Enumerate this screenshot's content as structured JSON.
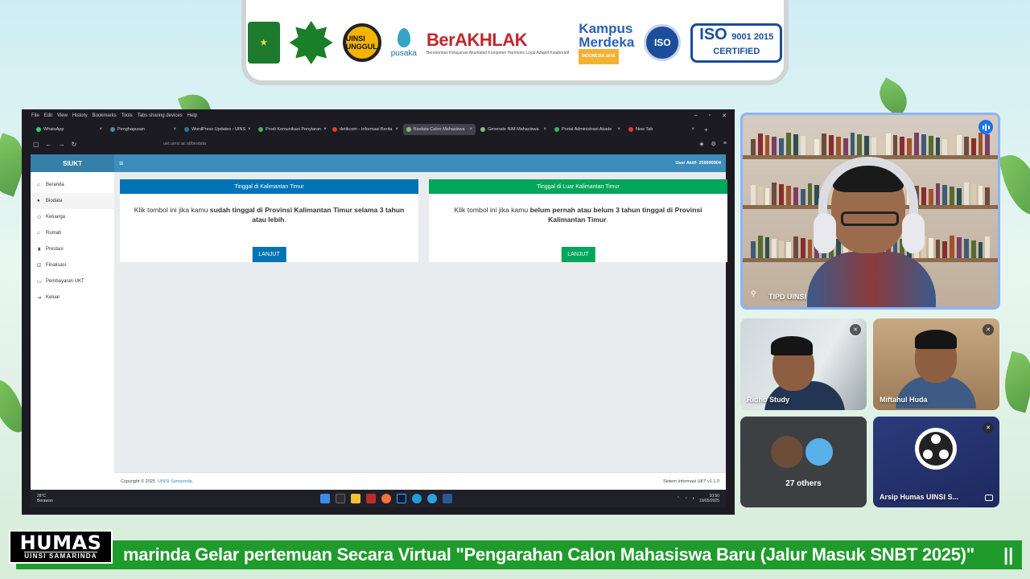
{
  "logos": {
    "uinsi_text": "UINSI UNGGUL",
    "pusaka": "pusaka",
    "berakhlak": "BerAKHLAK",
    "berakhlak_sub": "Berorientasi Pelayanan Akuntabel Kompeten Harmonis Loyal Adaptif Kolaboratif",
    "kampus": "Kampus",
    "merdeka": "Merdeka",
    "merdeka_sub": "INDONESIA JAYA",
    "iso_round": "ISO",
    "iso": "ISO",
    "iso_numbers": "9001 2015",
    "iso_certified": "CERTIFIED"
  },
  "browser": {
    "menu": [
      "File",
      "Edit",
      "View",
      "History",
      "Bookmarks",
      "Tools",
      "Tabs sharing devices",
      "Help"
    ],
    "tabs": [
      {
        "label": "WhatsApp",
        "active": false
      },
      {
        "label": "Penghapusan",
        "active": false
      },
      {
        "label": "WordPress Updates ‹ UINS",
        "active": false
      },
      {
        "label": "Prodi Komunikasi Penyiaran",
        "active": false
      },
      {
        "label": "detikcom - Informasi Berita",
        "active": false
      },
      {
        "label": "Biodata Calon Mahasiswa",
        "active": true
      },
      {
        "label": "Generate NIM Mahasiswa",
        "active": false
      },
      {
        "label": "Portal Administrasi Akade",
        "active": false
      },
      {
        "label": "New Tab",
        "active": false
      }
    ],
    "url": "ukt.uinsi.ac.id/biodata"
  },
  "app": {
    "brand": "SIUKT",
    "user_aktif": "User Aktif: 259999904",
    "sidebar": [
      {
        "label": "Beranda",
        "icon": "home-icon"
      },
      {
        "label": "Biodata",
        "icon": "user-icon"
      },
      {
        "label": "Keluarga",
        "icon": "users-icon"
      },
      {
        "label": "Rumah",
        "icon": "house-icon"
      },
      {
        "label": "Prestasi",
        "icon": "trophy-icon"
      },
      {
        "label": "Finalisasi",
        "icon": "check-icon"
      },
      {
        "label": "Pembayaran UKT",
        "icon": "card-icon"
      },
      {
        "label": "Keluar",
        "icon": "logout-icon"
      }
    ],
    "card_left": {
      "title": "Tinggal di Kalimantan Timur",
      "text_a": "Klik tombol ini jika kamu ",
      "text_bold": "sudah tinggal di Provinsi Kalimantan Timur selama 3 tahun atau lebih",
      "text_end": ".",
      "button": "LANJUT",
      "color": "#0073b7"
    },
    "card_right": {
      "title": "Tinggal di Luar Kalimantan Timur",
      "text_a": "Klik tombol ini jika kamu ",
      "text_bold": "belum pernah atau belum 3 tahun tinggal di Provinsi Kalimantan Timur",
      "text_end": ".",
      "button": "LANJUT",
      "color": "#00a65a"
    },
    "footer_copyright": "Copyright © 2025",
    "footer_link": "UINSI Samarinda.",
    "footer_version": "Sistem Informasi UKT v1.1.0"
  },
  "taskbar": {
    "temp": "28°C",
    "weather": "Berawan",
    "time": "10:50",
    "date": "19/05/2025"
  },
  "meeting": {
    "main_name": "TIPD UINSI",
    "tile2": "Ridho Study",
    "tile3": "Miftahul Huda",
    "others": "27 others",
    "tile5": "Arsip Humas UINSI S..."
  },
  "ticker": {
    "text": "marinda Gelar pertemuan Secara Virtual \"Pengarahan Calon Mahasiswa Baru (Jalur Masuk SNBT 2025)\"",
    "pause": "||"
  },
  "humas": {
    "title": "HUMAS",
    "subtitle": "UINSI SAMARINDA"
  }
}
